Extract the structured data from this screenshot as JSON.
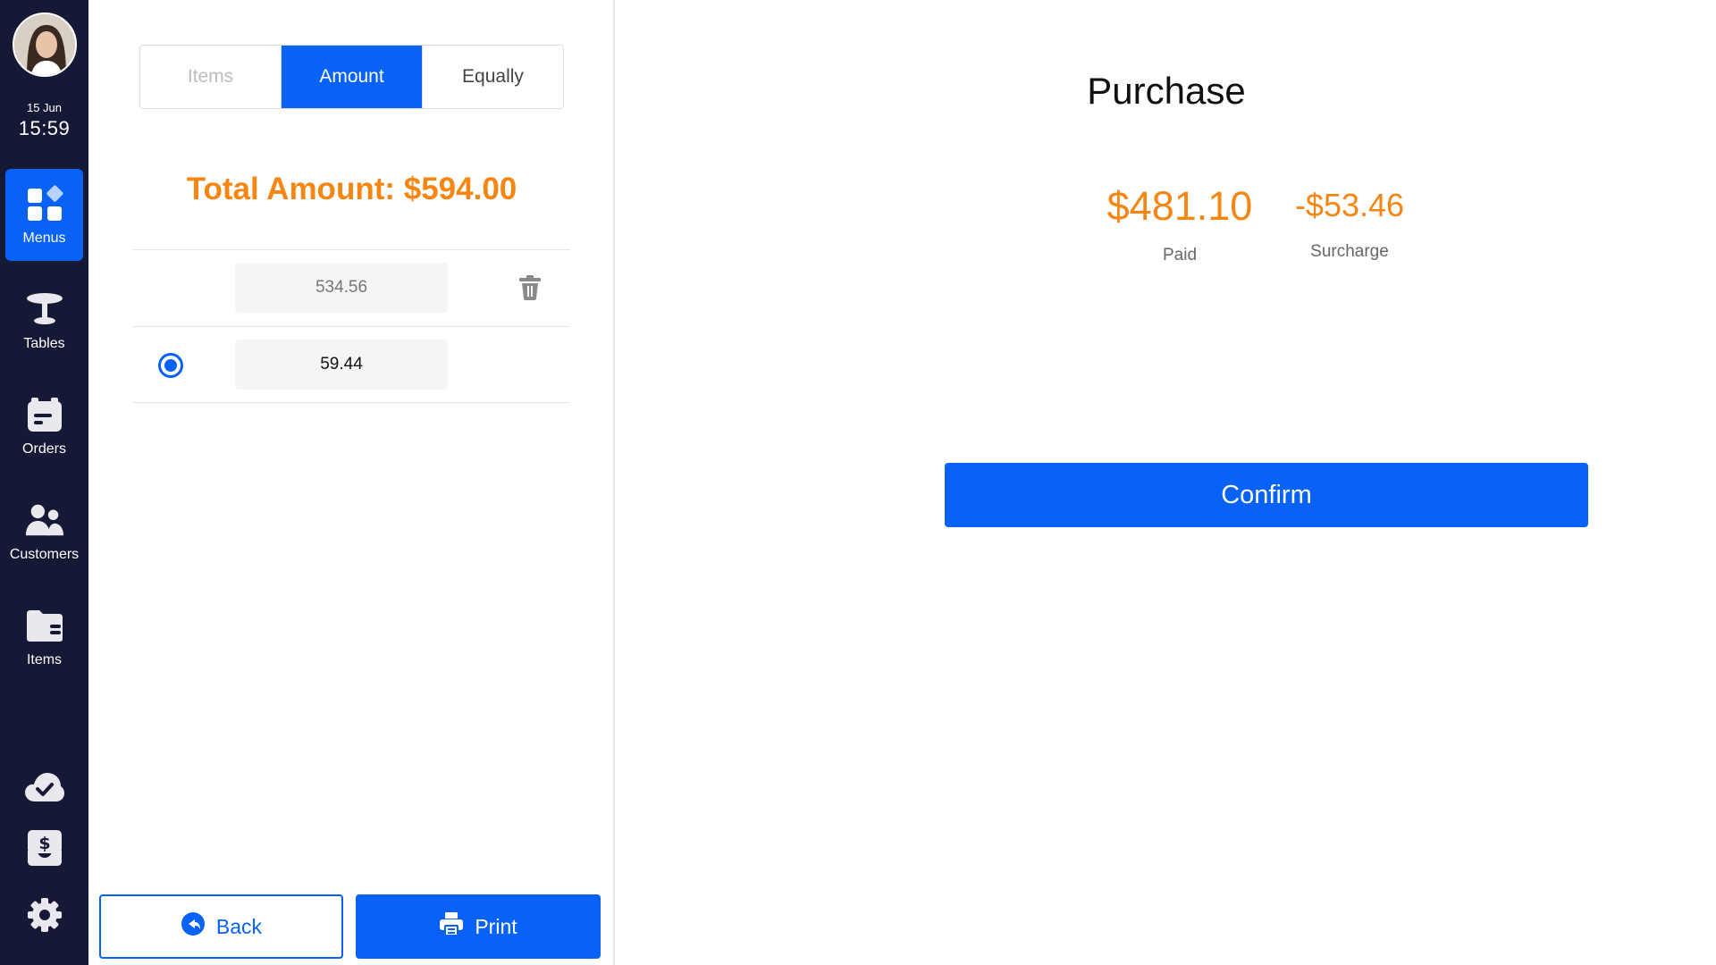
{
  "sidebar": {
    "date": "15 Jun",
    "time": "15:59",
    "items": [
      {
        "label": "Menus",
        "icon": "menus-icon",
        "active": true
      },
      {
        "label": "Tables",
        "icon": "table-icon"
      },
      {
        "label": "Orders",
        "icon": "orders-icon"
      },
      {
        "label": "Customers",
        "icon": "customers-icon"
      },
      {
        "label": "Items",
        "icon": "items-icon"
      }
    ],
    "bottom_icons": [
      "cloud-check-icon",
      "cash-drawer-icon",
      "gear-icon"
    ]
  },
  "split": {
    "tabs": [
      {
        "label": "Items",
        "state": "disabled"
      },
      {
        "label": "Amount",
        "state": "active"
      },
      {
        "label": "Equally",
        "state": "normal"
      }
    ],
    "total_label": "Total Amount: $594.00",
    "rows": [
      {
        "amount": "534.56",
        "selected": false,
        "deletable": true
      },
      {
        "amount": "59.44",
        "selected": true,
        "deletable": false
      }
    ],
    "back_label": "Back",
    "print_label": "Print"
  },
  "purchase": {
    "title": "Purchase",
    "paid_value": "$481.10",
    "paid_label": "Paid",
    "surcharge_value": "-$53.46",
    "surcharge_label": "Surcharge",
    "confirm_label": "Confirm"
  },
  "colors": {
    "accent": "#0962f6",
    "sidebar_bg": "#151936",
    "amount_orange": "#f58613"
  }
}
